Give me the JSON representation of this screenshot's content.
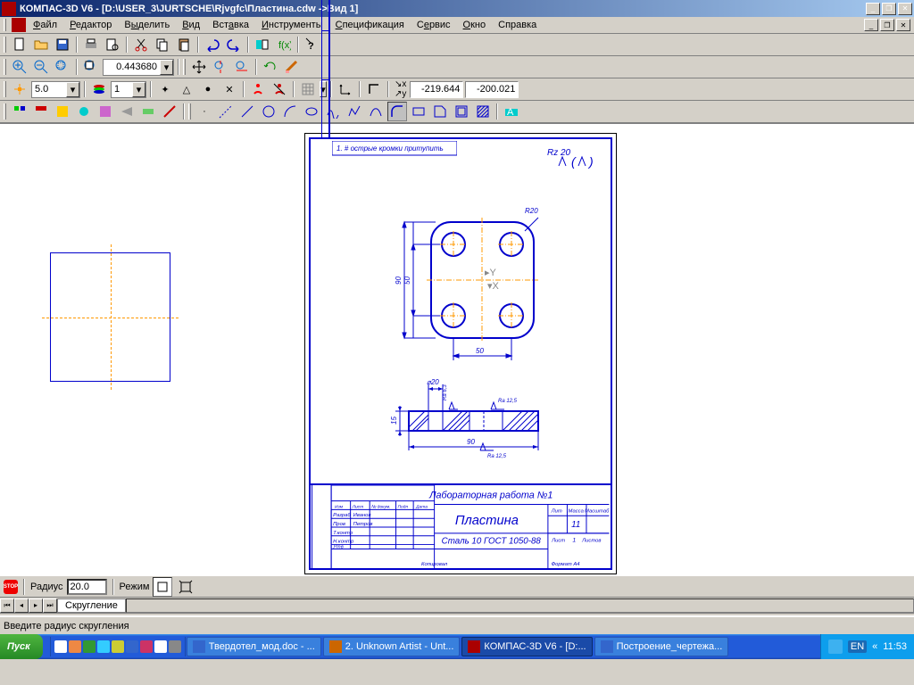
{
  "title": "КОМПАС-3D V6 - [D:\\USER_3\\JURTSCHE\\Rjvgfc\\Пластина.cdw ->Вид 1]",
  "menu": [
    "Файл",
    "Редактор",
    "Выделить",
    "Вид",
    "Вставка",
    "Инструменты",
    "Спецификация",
    "Сервис",
    "Окно",
    "Справка"
  ],
  "zoom_value": "0.443680",
  "step_value": "5.0",
  "layer_value": "1",
  "coord_x": "-219.644",
  "coord_y": "-200.021",
  "param_label": "Радиус",
  "param_value": "20.0",
  "mode_label": "Режим",
  "tab_name": "Скругление",
  "status": "Введите радиус скругления",
  "drawing": {
    "top_note": "1. # острые кромки притупить",
    "rz": "Rz 20",
    "r20": "R20",
    "dim90v": "90",
    "dim50v": "50",
    "dim50h": "50",
    "d20": "⌀20",
    "ra63": "Ra 6,3",
    "ra125": "Ra 12,5",
    "dim15": "15",
    "dim90h": "90",
    "title1": "Лабораторная работа №1",
    "title2": "Пластина",
    "material": "Сталь 10 ГОСТ 1050-88",
    "copy": "Копировал",
    "format": "Формат    А4",
    "mass": "11",
    "scale": "Масштаб",
    "massL": "Масса",
    "litL": "Лит",
    "listL": "Лист",
    "listovL": "Листов",
    "list1": "1",
    "razrab": "Разраб",
    "razrabN": "Иванов",
    "prov": "Пров",
    "provN": "Петров",
    "tkontr": "Т.контр",
    "nkontr": "Н.контр",
    "utv": "Утв",
    "izm": "Изм",
    "list": "Лист",
    "ndokum": "№ докум.",
    "podp": "Подп",
    "data": "Дата"
  },
  "taskbar": {
    "start": "Пуск",
    "items": [
      "Твердотел_мод.doc - ...",
      "2. Unknown Artist - Unt...",
      "КОМПАС-3D V6 - [D:...",
      "Построение_чертежа..."
    ],
    "lang": "EN",
    "time": "11:53"
  }
}
